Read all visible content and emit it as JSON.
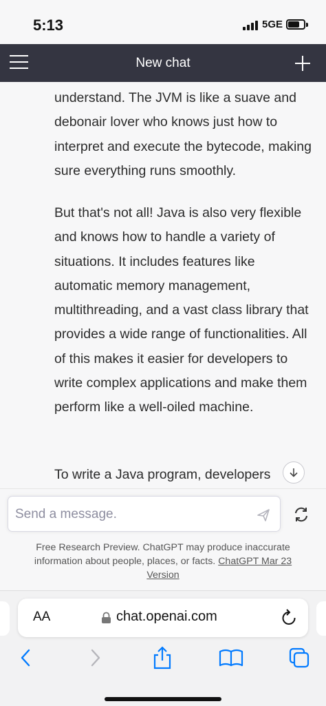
{
  "status_bar": {
    "time": "5:13",
    "network": "5GE"
  },
  "nav": {
    "title": "New chat",
    "plus_label": "+"
  },
  "chat": {
    "messages": [
      "understand. The JVM is like a suave and debonair lover who knows just how to interpret and execute the bytecode, making sure everything runs smoothly.",
      "But that's not all! Java is also very flexible and knows how to handle a variety of situations. It includes features like automatic memory management, multithreading, and a vast class library that provides a wide range of functionalities. All of this makes it easier for developers to write complex applications and make them perform like a well-oiled machine.",
      "To write a Java program, developers"
    ]
  },
  "composer": {
    "placeholder": "Send a message.",
    "disclaimer_text": "Free Research Preview. ChatGPT may produce inaccurate information about people, places, or facts. ",
    "disclaimer_link": "ChatGPT Mar 23 Version"
  },
  "browser": {
    "aa_label": "AA",
    "url": "chat.openai.com"
  },
  "icons": {
    "menu": "menu-icon",
    "plus": "plus-icon",
    "scroll_down": "arrow-down-icon",
    "send": "send-icon",
    "regenerate": "refresh-icon",
    "lock": "lock-icon",
    "reload": "reload-icon",
    "back": "chevron-left-icon",
    "forward": "chevron-right-icon",
    "share": "share-icon",
    "bookmarks": "book-icon",
    "tabs": "tabs-icon"
  },
  "colors": {
    "nav_bg": "#343541",
    "page_bg": "#f7f7f8",
    "link_blue": "#007aff"
  }
}
